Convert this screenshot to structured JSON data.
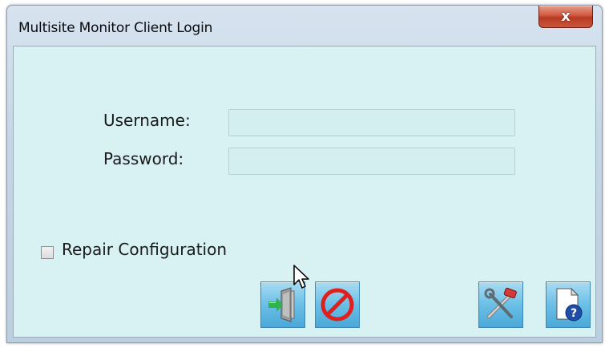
{
  "window": {
    "title": "Multisite Monitor Client Login",
    "close_glyph": "x"
  },
  "form": {
    "username_label": "Username:",
    "username_value": "",
    "password_label": "Password:",
    "password_value": "",
    "repair_label": "Repair Configuration",
    "repair_checked": false
  },
  "toolbar": {
    "buttons": [
      {
        "icon": "login-door-icon"
      },
      {
        "icon": "cancel-icon"
      },
      {
        "icon": "tools-icon"
      },
      {
        "icon": "help-document-icon"
      }
    ]
  },
  "colors": {
    "client_bg": "#d8f1f3",
    "button_blue": "#6bbfe6",
    "cancel_red": "#e0201c",
    "close_red": "#c8563c"
  }
}
